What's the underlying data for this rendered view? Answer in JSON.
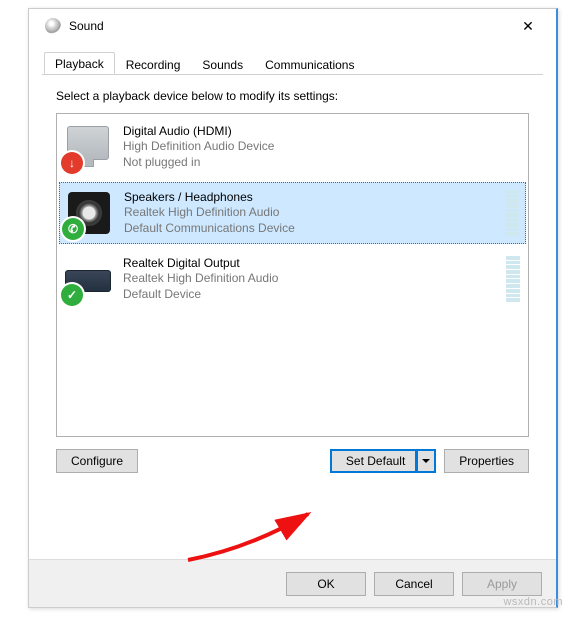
{
  "window": {
    "title": "Sound",
    "close": "✕"
  },
  "tabs": {
    "playback": "Playback",
    "recording": "Recording",
    "sounds": "Sounds",
    "communications": "Communications"
  },
  "instruction": "Select a playback device below to modify its settings:",
  "devices": [
    {
      "title": "Digital Audio (HDMI)",
      "sub1": "High Definition Audio Device",
      "sub2": "Not plugged in"
    },
    {
      "title": "Speakers / Headphones",
      "sub1": "Realtek High Definition Audio",
      "sub2": "Default Communications Device"
    },
    {
      "title": "Realtek Digital Output",
      "sub1": "Realtek High Definition Audio",
      "sub2": "Default Device"
    }
  ],
  "buttons": {
    "configure": "Configure",
    "set_default": "Set Default",
    "properties": "Properties",
    "ok": "OK",
    "cancel": "Cancel",
    "apply": "Apply"
  },
  "overlay_glyphs": {
    "down_arrow": "↓",
    "phone": "✆",
    "check": "✓"
  },
  "watermark": "wsxdn.com"
}
